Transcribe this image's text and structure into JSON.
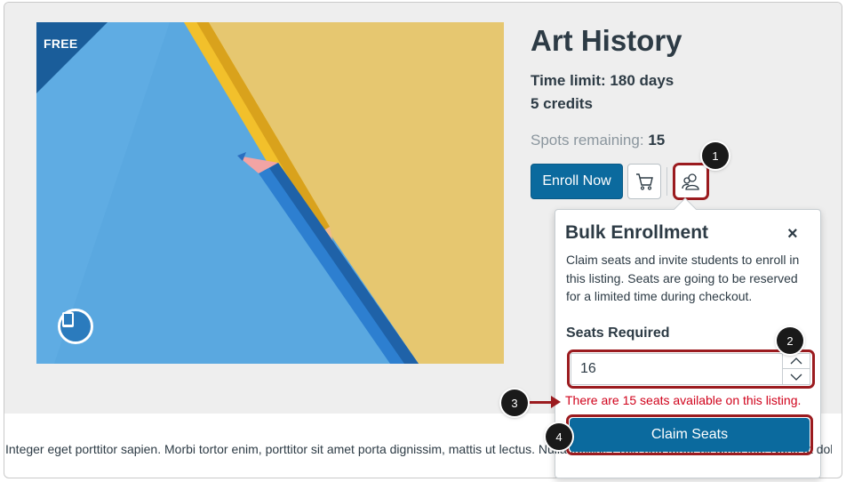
{
  "course": {
    "badge": "FREE",
    "title": "Art History",
    "time_limit": "Time limit: 180 days",
    "credits": "5 credits",
    "spots_label": "Spots remaining:",
    "spots_value": "15"
  },
  "actions": {
    "enroll_label": "Enroll Now",
    "cart_icon": "shopping-cart-icon",
    "bulk_icon": "bulk-enrollment-users-icon"
  },
  "bulk_enrollment": {
    "title": "Bulk Enrollment",
    "close_label": "×",
    "description": "Claim seats and invite students to enroll in this listing. Seats are going to be reserved for a limited time during checkout.",
    "seats_label": "Seats Required",
    "seats_value": "16",
    "error_message": "There are 15 seats available on this listing.",
    "claim_label": "Claim Seats"
  },
  "callouts": [
    "1",
    "2",
    "3",
    "4"
  ],
  "body_text": "Integer eget porttitor sapien. Morbi tortor enim, porttitor sit amet porta dignissim, mattis ut lectus. Nulla facilisi. Proin sed tortor sit amet leo. Nunc ut dolor nec",
  "colors": {
    "primary_button": "#0b6a9e",
    "annotation": "#9b1b1f",
    "error": "#d0021b",
    "text": "#2d3b45"
  }
}
